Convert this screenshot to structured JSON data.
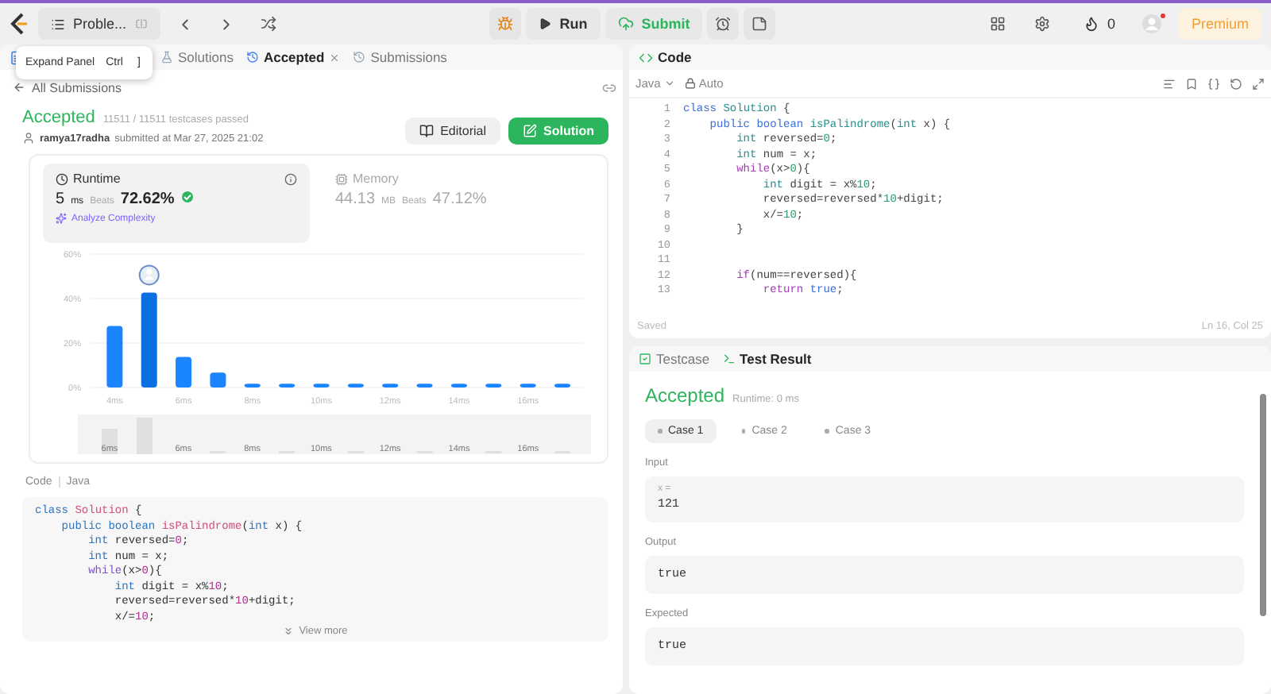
{
  "top_bar": {
    "problem_button": "Proble...",
    "run": "Run",
    "submit": "Submit",
    "streak_count": "0",
    "premium": "Premium"
  },
  "tooltip": {
    "label": "Expand Panel",
    "keys": [
      "Ctrl",
      "]"
    ]
  },
  "left_tabs": [
    {
      "label": "Solutions",
      "kind": "solutions",
      "selected": false,
      "closable": false
    },
    {
      "label": "Accepted",
      "kind": "result",
      "selected": true,
      "closable": true
    },
    {
      "label": "Submissions",
      "kind": "history",
      "selected": false,
      "closable": false
    }
  ],
  "back_link": "All Submissions",
  "submission": {
    "status": "Accepted",
    "passed": "11511 / 11511 testcases passed",
    "user": "ramya17radha",
    "submitted": "submitted at Mar 27, 2025 21:02",
    "buttons": [
      {
        "label": "Editorial",
        "kind": "plain"
      },
      {
        "label": "Solution",
        "kind": "primary"
      }
    ]
  },
  "metrics": [
    {
      "kind": "runtime",
      "title": "Runtime",
      "value": "5",
      "unit": "ms",
      "beats_label": "Beats",
      "beats": "72.62%",
      "link": "Analyze Complexity",
      "selected": true
    },
    {
      "kind": "memory",
      "title": "Memory",
      "value": "44.13",
      "unit": "MB",
      "beats_label": "Beats",
      "beats": "47.12%",
      "selected": false
    }
  ],
  "chart_data": {
    "type": "bar",
    "x": [
      4,
      5,
      6,
      7,
      8,
      9,
      10,
      11,
      12,
      13,
      14,
      15,
      16,
      17
    ],
    "values": [
      27,
      42,
      13,
      6,
      1,
      1,
      1,
      1,
      1,
      1,
      1,
      1,
      1,
      1
    ],
    "xticks": [
      {
        "value": 4,
        "label": "4ms"
      },
      {
        "value": 6,
        "label": "6ms"
      },
      {
        "value": 8,
        "label": "8ms"
      },
      {
        "value": 10,
        "label": "10ms"
      },
      {
        "value": 12,
        "label": "12ms"
      },
      {
        "value": 14,
        "label": "14ms"
      },
      {
        "value": 16,
        "label": "16ms"
      }
    ],
    "xlim": [
      3.3,
      17.6
    ],
    "yticks": [
      {
        "value": 0,
        "label": "0%"
      },
      {
        "value": 20,
        "label": "20%"
      },
      {
        "value": 40,
        "label": "40%"
      },
      {
        "value": 60,
        "label": "60%"
      }
    ],
    "ylim": [
      0,
      60
    ]
  },
  "range_labels": [
    "6ms",
    "6ms",
    "8ms",
    "10ms",
    "12ms",
    "14ms",
    "16ms"
  ],
  "code_label": "Code",
  "code_language": "Java",
  "submitted_code": [
    {
      "tokens": [
        {
          "kind": "keyword",
          "text": "class "
        },
        {
          "kind": "name",
          "text": "Solution"
        },
        {
          "kind": "plain",
          "text": " {"
        }
      ]
    },
    {
      "tokens": [
        {
          "kind": "keyword",
          "text": "    public boolean "
        },
        {
          "kind": "name",
          "text": "isPalindrome"
        },
        {
          "kind": "plain",
          "text": "("
        },
        {
          "kind": "type",
          "text": "int"
        },
        {
          "kind": "plain",
          "text": " x) {"
        }
      ]
    },
    {
      "tokens": [
        {
          "kind": "type",
          "text": "        int"
        },
        {
          "kind": "plain",
          "text": " reversed="
        },
        {
          "kind": "number",
          "text": "0"
        },
        {
          "kind": "plain",
          "text": ";"
        }
      ]
    },
    {
      "tokens": [
        {
          "kind": "type",
          "text": "        int"
        },
        {
          "kind": "plain",
          "text": " num = x;"
        }
      ]
    },
    {
      "tokens": [
        {
          "kind": "control",
          "text": "        while"
        },
        {
          "kind": "plain",
          "text": "(x>"
        },
        {
          "kind": "number",
          "text": "0"
        },
        {
          "kind": "plain",
          "text": "){"
        }
      ]
    },
    {
      "tokens": [
        {
          "kind": "type",
          "text": "            int"
        },
        {
          "kind": "plain",
          "text": " digit = x%"
        },
        {
          "kind": "number",
          "text": "10"
        },
        {
          "kind": "plain",
          "text": ";"
        }
      ]
    },
    {
      "tokens": [
        {
          "kind": "plain",
          "text": "            reversed=reversed*"
        },
        {
          "kind": "number",
          "text": "10"
        },
        {
          "kind": "plain",
          "text": "+digit;"
        }
      ]
    },
    {
      "tokens": [
        {
          "kind": "plain",
          "text": "            x/="
        },
        {
          "kind": "number",
          "text": "10"
        },
        {
          "kind": "plain",
          "text": ";"
        }
      ]
    }
  ],
  "view_more": "View more",
  "editor": {
    "title": "Code",
    "language": "Java",
    "mode": "Auto",
    "status": "Saved",
    "cursor": "Ln 16, Col 25",
    "lines": [
      {
        "number": "1",
        "tokens": [
          {
            "kind": "keyword",
            "text": "class "
          },
          {
            "kind": "name",
            "text": "Solution"
          },
          {
            "kind": "plain",
            "text": " {"
          }
        ]
      },
      {
        "number": "2",
        "tokens": [
          {
            "kind": "keyword",
            "text": "    public boolean "
          },
          {
            "kind": "name",
            "text": "isPalindrome"
          },
          {
            "kind": "plain",
            "text": "("
          },
          {
            "kind": "type",
            "text": "int"
          },
          {
            "kind": "plain",
            "text": " x) {"
          }
        ]
      },
      {
        "number": "3",
        "tokens": [
          {
            "kind": "type",
            "text": "        int"
          },
          {
            "kind": "plain",
            "text": " reversed="
          },
          {
            "kind": "number",
            "text": "0"
          },
          {
            "kind": "plain",
            "text": ";"
          }
        ]
      },
      {
        "number": "4",
        "tokens": [
          {
            "kind": "type",
            "text": "        int"
          },
          {
            "kind": "plain",
            "text": " num = x;"
          }
        ]
      },
      {
        "number": "5",
        "tokens": [
          {
            "kind": "control",
            "text": "        while"
          },
          {
            "kind": "plain",
            "text": "(x>"
          },
          {
            "kind": "number",
            "text": "0"
          },
          {
            "kind": "plain",
            "text": "){"
          }
        ]
      },
      {
        "number": "6",
        "tokens": [
          {
            "kind": "type",
            "text": "            int"
          },
          {
            "kind": "plain",
            "text": " digit = x%"
          },
          {
            "kind": "number",
            "text": "10"
          },
          {
            "kind": "plain",
            "text": ";"
          }
        ]
      },
      {
        "number": "7",
        "tokens": [
          {
            "kind": "plain",
            "text": "            reversed=reversed*"
          },
          {
            "kind": "number",
            "text": "10"
          },
          {
            "kind": "plain",
            "text": "+digit;"
          }
        ]
      },
      {
        "number": "8",
        "tokens": [
          {
            "kind": "plain",
            "text": "            x/="
          },
          {
            "kind": "number",
            "text": "10"
          },
          {
            "kind": "plain",
            "text": ";"
          }
        ]
      },
      {
        "number": "9",
        "tokens": [
          {
            "kind": "plain",
            "text": "        }"
          }
        ]
      },
      {
        "number": "10"
      },
      {
        "number": "11"
      },
      {
        "number": "12",
        "tokens": [
          {
            "kind": "control",
            "text": "        if"
          },
          {
            "kind": "plain",
            "text": "(num==reversed){"
          }
        ]
      },
      {
        "number": "13",
        "tokens": [
          {
            "kind": "control",
            "text": "            return "
          },
          {
            "kind": "keyword",
            "text": "true"
          },
          {
            "kind": "plain",
            "text": ";"
          }
        ]
      }
    ]
  },
  "bottom_tabs": [
    {
      "label": "Testcase",
      "kind": "testcase",
      "selected": false
    },
    {
      "label": "Test Result",
      "kind": "terminal",
      "selected": true
    }
  ],
  "result": {
    "status": "Accepted",
    "runtime": "Runtime: 0 ms",
    "cases": [
      {
        "label": "Case 1",
        "selected": true
      },
      {
        "label": "Case 2",
        "selected": false
      },
      {
        "label": "Case 3",
        "selected": false
      }
    ],
    "input_label": "Input",
    "input_var": "x =",
    "input_value": "121",
    "output_label": "Output",
    "output_value": "true",
    "expected_label": "Expected",
    "expected_value": "true"
  }
}
